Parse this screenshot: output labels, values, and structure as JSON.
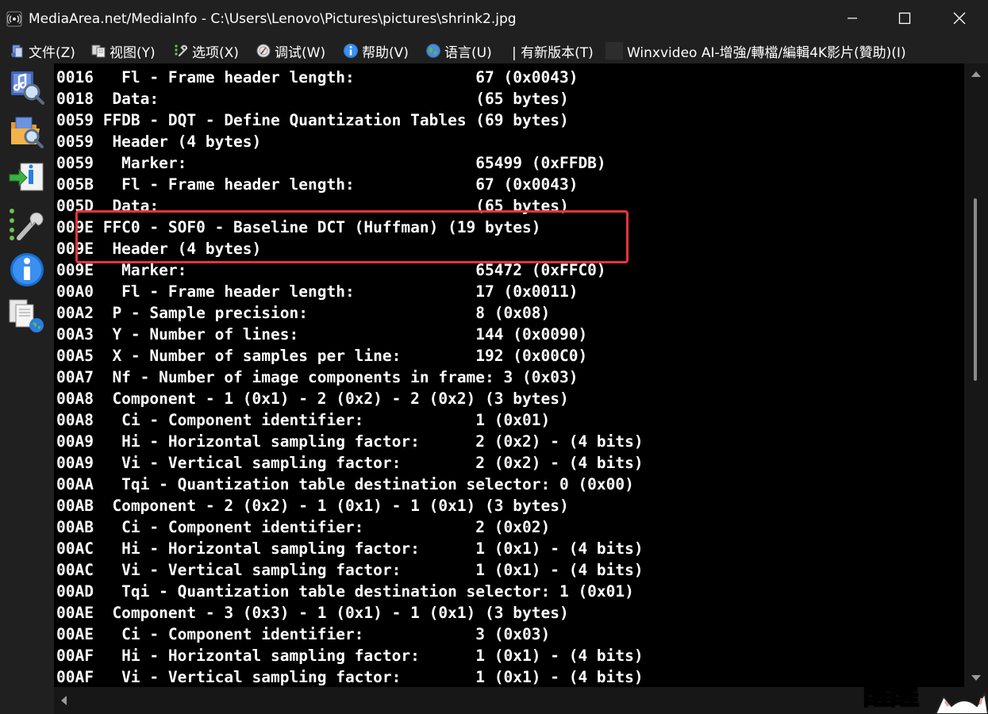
{
  "window": {
    "title": "MediaArea.net/MediaInfo - C:\\Users\\Lenovo\\Pictures\\pictures\\shrink2.jpg"
  },
  "menu": {
    "items": [
      {
        "label": "文件(Z)",
        "icon": "file-icon"
      },
      {
        "label": "视图(Y)",
        "icon": "view-icon"
      },
      {
        "label": "选项(X)",
        "icon": "options-icon"
      },
      {
        "label": "调试(W)",
        "icon": "debug-icon"
      },
      {
        "label": "帮助(V)",
        "icon": "help-icon"
      },
      {
        "label": "语言(U)",
        "icon": "language-icon"
      },
      {
        "label": "| 有新版本(T)",
        "icon": ""
      },
      {
        "label": "Winxvideo AI-增強/轉檔/編輯4K影片(贊助)(I)",
        "icon": "sponsor-icon"
      }
    ]
  },
  "sidebar": {
    "items": [
      {
        "name": "open-file-icon"
      },
      {
        "name": "open-folder-icon"
      },
      {
        "name": "export-icon"
      },
      {
        "name": "preferences-icon"
      },
      {
        "name": "about-icon"
      },
      {
        "name": "web-icon"
      }
    ]
  },
  "content": {
    "lines": [
      "0016   Fl - Frame header length:             67 (0x0043)",
      "0018  Data:                                  (65 bytes)",
      "0059 FFDB - DQT - Define Quantization Tables (69 bytes)",
      "0059  Header (4 bytes)",
      "0059   Marker:                               65499 (0xFFDB)",
      "005B   Fl - Frame header length:             67 (0x0043)",
      "005D  Data:                                  (65 bytes)",
      "009E FFC0 - SOF0 - Baseline DCT (Huffman) (19 bytes)",
      "009E  Header (4 bytes)",
      "009E   Marker:                               65472 (0xFFC0)",
      "00A0   Fl - Frame header length:             17 (0x0011)",
      "00A2  P - Sample precision:                  8 (0x08)",
      "00A3  Y - Number of lines:                   144 (0x0090)",
      "00A5  X - Number of samples per line:        192 (0x00C0)",
      "00A7  Nf - Number of image components in frame: 3 (0x03)",
      "00A8  Component - 1 (0x1) - 2 (0x2) - 2 (0x2) (3 bytes)",
      "00A8   Ci - Component identifier:            1 (0x01)",
      "00A9   Hi - Horizontal sampling factor:      2 (0x2) - (4 bits)",
      "00A9   Vi - Vertical sampling factor:        2 (0x2) - (4 bits)",
      "00AA   Tqi - Quantization table destination selector: 0 (0x00)",
      "00AB  Component - 2 (0x2) - 1 (0x1) - 1 (0x1) (3 bytes)",
      "00AB   Ci - Component identifier:            2 (0x02)",
      "00AC   Hi - Horizontal sampling factor:      1 (0x1) - (4 bits)",
      "00AC   Vi - Vertical sampling factor:        1 (0x1) - (4 bits)",
      "00AD   Tqi - Quantization table destination selector: 1 (0x01)",
      "00AE  Component - 3 (0x3) - 1 (0x1) - 1 (0x1) (3 bytes)",
      "00AE   Ci - Component identifier:            3 (0x03)",
      "00AF   Hi - Horizontal sampling factor:      1 (0x1) - (4 bits)",
      "00AF   Vi - Vertical sampling factor:        1 (0x1) - (4 bits)"
    ]
  },
  "annotation": {
    "color": "#e8343a"
  },
  "watermark": {
    "text": "醒醒"
  },
  "colors": {
    "background": "#000000",
    "chrome": "#202020",
    "text": "#ffffff"
  }
}
